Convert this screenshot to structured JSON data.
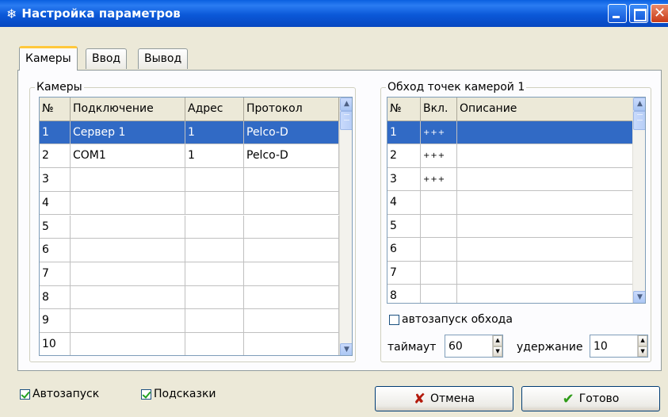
{
  "window": {
    "title": "Настройка параметров"
  },
  "tabs": [
    {
      "label": "Камеры",
      "active": true
    },
    {
      "label": "Ввод",
      "active": false
    },
    {
      "label": "Вывод",
      "active": false
    }
  ],
  "cameras": {
    "group_title": "Камеры",
    "headers": [
      "№",
      "Подключение",
      "Адрес",
      "Протокол"
    ],
    "rows": [
      [
        "1",
        "Сервер 1",
        "1",
        "Pelco-D"
      ],
      [
        "2",
        "COM1",
        "1",
        "Pelco-D"
      ],
      [
        "3",
        "",
        "",
        ""
      ],
      [
        "4",
        "",
        "",
        ""
      ],
      [
        "5",
        "",
        "",
        ""
      ],
      [
        "6",
        "",
        "",
        ""
      ],
      [
        "7",
        "",
        "",
        ""
      ],
      [
        "8",
        "",
        "",
        ""
      ],
      [
        "9",
        "",
        "",
        ""
      ],
      [
        "10",
        "",
        "",
        ""
      ]
    ],
    "selected_row": 0
  },
  "tour": {
    "group_title": "Обход точек камерой 1",
    "headers": [
      "№",
      "Вкл.",
      "Описание"
    ],
    "rows": [
      [
        "1",
        "+++",
        ""
      ],
      [
        "2",
        "+++",
        ""
      ],
      [
        "3",
        "+++",
        ""
      ],
      [
        "4",
        "",
        ""
      ],
      [
        "5",
        "",
        ""
      ],
      [
        "6",
        "",
        ""
      ],
      [
        "7",
        "",
        ""
      ],
      [
        "8",
        "",
        ""
      ]
    ],
    "selected_row": 0,
    "autostart_label": "автозапуск обхода",
    "autostart_checked": false,
    "timeout_label": "таймаут",
    "timeout_value": "60",
    "hold_label": "удержание",
    "hold_value": "10"
  },
  "footer": {
    "autostart_label": "Автозапуск",
    "autostart_checked": true,
    "hints_label": "Подсказки",
    "hints_checked": true,
    "cancel_label": "Отмена",
    "ok_label": "Готово"
  }
}
